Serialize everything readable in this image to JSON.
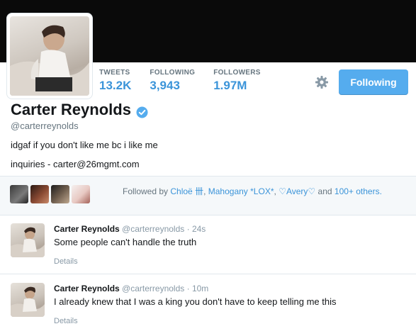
{
  "profile": {
    "name": "Carter Reynolds",
    "handle": "@carterreynolds",
    "bio": "idgaf if you don't like me bc i like me",
    "contact": "inquiries - carter@26mgmt.com",
    "verified": true
  },
  "stats": [
    {
      "label": "TWEETS",
      "value": "13.2K"
    },
    {
      "label": "FOLLOWING",
      "value": "3,943"
    },
    {
      "label": "FOLLOWERS",
      "value": "1.97M"
    }
  ],
  "actions": {
    "follow_label": "Following",
    "settings_icon": "gear-icon"
  },
  "followed_by": {
    "prefix": "Followed by",
    "users": [
      "Chloë 卌",
      "Mahogany *LOX*",
      "♡Avery♡"
    ],
    "sep1": ",",
    "sep2": ",",
    "and": "and",
    "more": "100+ others."
  },
  "tweets": [
    {
      "name": "Carter Reynolds",
      "handle": "@carterreynolds",
      "time": "· 24s",
      "text": "Some people can't handle the truth",
      "details": "Details"
    },
    {
      "name": "Carter Reynolds",
      "handle": "@carterreynolds",
      "time": "· 10m",
      "text": "I already knew that I was a king you don't have to keep telling me this",
      "details": "Details"
    }
  ],
  "colors": {
    "accent": "#55acee",
    "link": "#3b94d9",
    "banner": "#0a0a0a"
  }
}
